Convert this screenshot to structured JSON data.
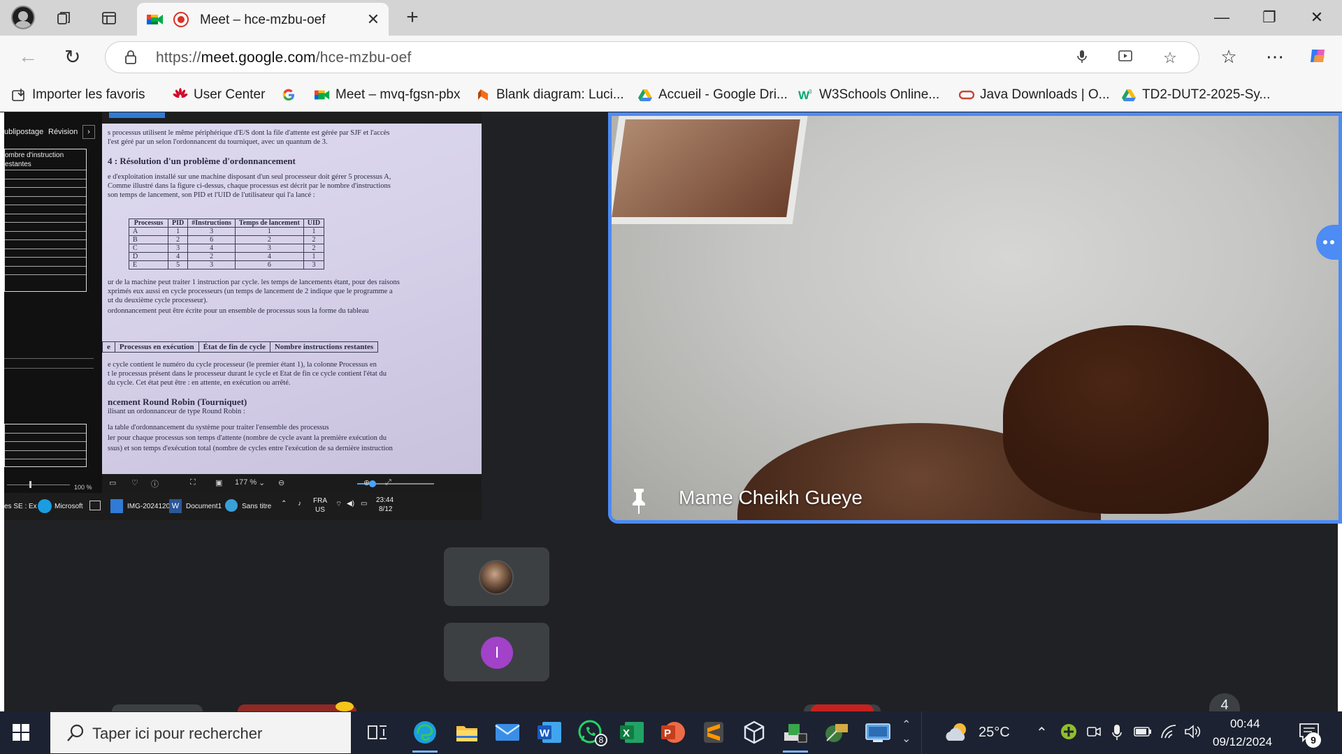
{
  "browser": {
    "tab_title": "Meet – hce-mzbu-oef",
    "tab_close": "✕",
    "new_tab": "+",
    "url_prefix": "https://",
    "url_domain": "meet.google.com",
    "url_path": "/hce-mzbu-oef",
    "window_controls": [
      "—",
      "❐",
      "✕"
    ],
    "bookmarks": [
      {
        "label": "Importer les favoris",
        "icon": "import-icon",
        "color": "#333333"
      },
      {
        "label": "User Center",
        "icon": "huawei-icon",
        "color": "#cf0a2c"
      },
      {
        "label": "",
        "icon": "google-icon",
        "color": "#4285f4"
      },
      {
        "label": "Meet – mvq-fgsn-pbx",
        "icon": "meet-icon",
        "color": "#00832d"
      },
      {
        "label": "Blank diagram: Luci...",
        "icon": "lucid-icon",
        "color": "#f96b13"
      },
      {
        "label": "Accueil - Google Dri...",
        "icon": "drive-icon",
        "color": "#1fa463"
      },
      {
        "label": "W3Schools Online...",
        "icon": "w3schools-icon",
        "color": "#04aa6d"
      },
      {
        "label": "Java Downloads | O...",
        "icon": "oracle-icon",
        "color": "#c74634"
      },
      {
        "label": "TD2-DUT2-2025-Sy...",
        "icon": "drive-icon",
        "color": "#1fa463"
      }
    ]
  },
  "share": {
    "ribbon_tabs": [
      "ublipostage",
      "Révision"
    ],
    "side_header": [
      "ombre d'instruction",
      "estantes"
    ],
    "doc_lines": [
      "s processus utilisent le même périphérique d'E/S dont la file d'attente est gérée par SJF et l'accès",
      "l'est géré par un selon l'ordonnancent du tourniquet, avec un quantum de 3.",
      "4 : Résolution d'un problème d'ordonnancement",
      "e d'exploitation installé sur une machine disposant d'un seul processeur doit gérer 5 processus A,",
      "Comme illustré dans la figure ci-dessus, chaque processus est décrit par le nombre d'instructions",
      "son temps de lancement, son PID et l'UID de l'utilisateur qui l'a lancé :",
      "ur de la machine peut traiter 1 instruction par cycle. les temps de lancements étant, pour des raisons",
      "xprimés eux aussi en cycle processeurs (un temps de lancement de 2 indique que le programme a",
      "ut du deuxième cycle processeur).",
      "ordonnancement peut être écrite pour un ensemble de processus sous la forme du tableau",
      "e cycle contient le numéro du cycle processeur (le premier étant 1), la colonne Processus en",
      "t le processus présent dans le processeur durant le cycle et Etat de fin ce cycle contient l'état du",
      "du cycle. Cet état peut être : en attente, en exécution ou arrêté.",
      "ncement Round Robin (Tourniquet)",
      "ilisant un ordonnanceur de type Round Robin :",
      "la table d'ordonnancement du système pour traiter l'ensemble des processus",
      "ler pour chaque processus son temps d'attente (nombre de cycle avant la première exécution du",
      "ssus) et son temps d'exécution total (nombre de cycles entre l'exécution de sa dernière instruction"
    ],
    "table_headers": [
      "Processus",
      "PID",
      "#Instructions",
      "Temps de lancement",
      "UID"
    ],
    "table_rows": [
      [
        "A",
        "1",
        "3",
        "1",
        "1"
      ],
      [
        "B",
        "2",
        "6",
        "2",
        "2"
      ],
      [
        "C",
        "3",
        "4",
        "3",
        "2"
      ],
      [
        "D",
        "4",
        "2",
        "4",
        "1"
      ],
      [
        "E",
        "5",
        "3",
        "6",
        "3"
      ]
    ],
    "row_table": [
      "e",
      "Processus en exécution",
      "État de fin de cycle",
      "Nombre instructions restantes"
    ],
    "word_zoom": "100 %",
    "photo_zoom": "177 %",
    "photo_zoom_fraction": 0.2,
    "taskbar": {
      "item1": "es SE : Ex",
      "item2": "Microsoft",
      "item3": "IMG-2024120",
      "item4": "Document1",
      "item5": "Sans titre",
      "lang1": "FRA",
      "lang2": "US",
      "time": "23:44",
      "date": "8/12"
    }
  },
  "camera": {
    "participant_name": "Mame Cheikh Gueye",
    "accent": "#4d8bf5"
  },
  "tiles": {
    "p2_initial": "I",
    "p2_color": "#a142c9"
  },
  "controls": {
    "hint": "4"
  },
  "taskbar": {
    "search_placeholder": "Taper ici pour rechercher",
    "whatsapp_badge": "8",
    "weather_temp": "25°C",
    "time": "00:44",
    "date": "09/12/2024",
    "notification_count": "9"
  }
}
